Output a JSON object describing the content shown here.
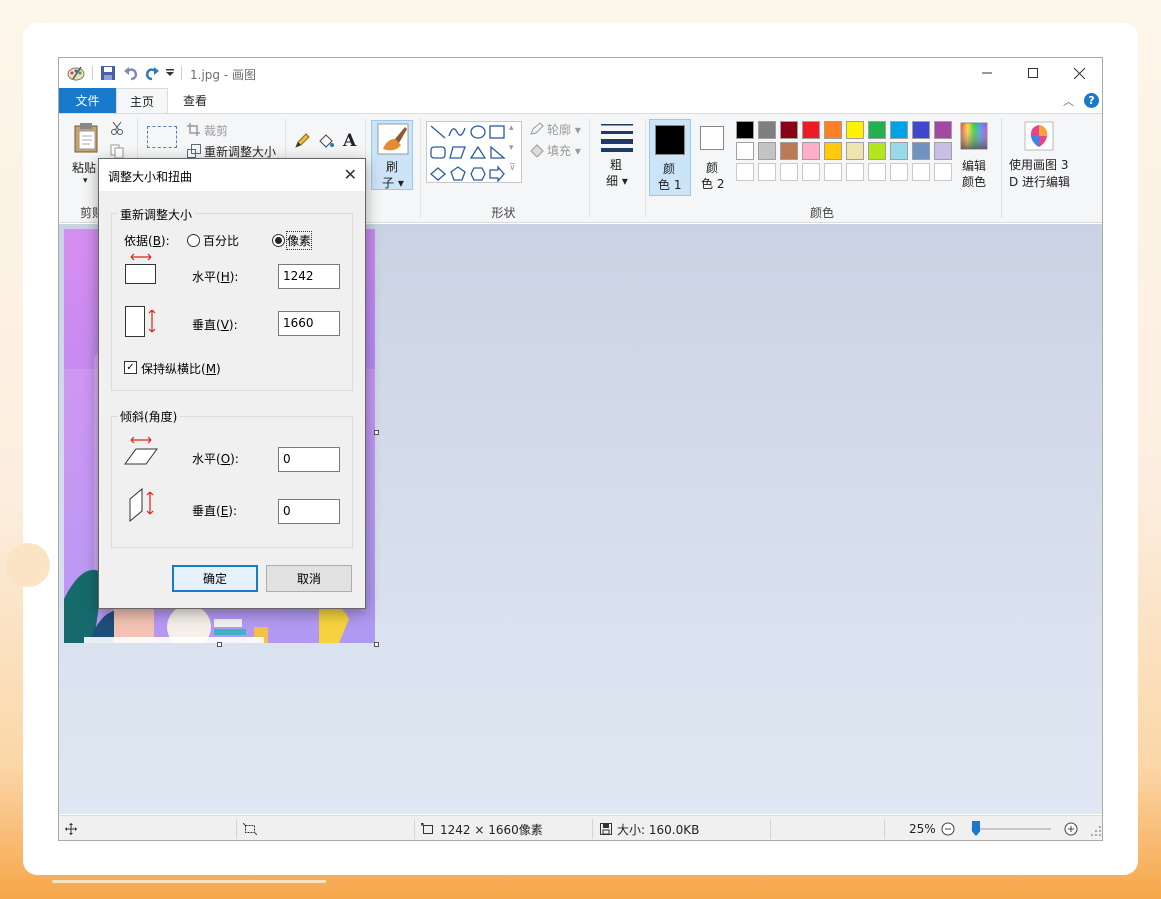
{
  "window": {
    "title": "1.jpg - 画图"
  },
  "tabs": {
    "file": "文件",
    "home": "主页",
    "view": "查看"
  },
  "ribbon": {
    "clipboard": {
      "paste": "粘贴",
      "group": "剪贴板"
    },
    "image": {
      "crop": "裁剪",
      "resize": "重新调整大小"
    },
    "brushes": {
      "label_line1": "刷",
      "label_line2": "子"
    },
    "shapes": {
      "outline": "轮廓",
      "fill": "填充",
      "group": "形状"
    },
    "size": {
      "label_line1": "粗",
      "label_line2": "细"
    },
    "colors": {
      "color1_line1": "颜",
      "color1_line2": "色 1",
      "color2_line1": "颜",
      "color2_line2": "色 2",
      "edit_line1": "编辑",
      "edit_line2": "颜色",
      "group": "颜色",
      "palette_row1": [
        "#000000",
        "#7f7f7f",
        "#880015",
        "#ed1c24",
        "#ff7f27",
        "#fff200",
        "#22b14c",
        "#00a2e8",
        "#3f48cc",
        "#a349a4"
      ],
      "palette_row2": [
        "#ffffff",
        "#c3c3c3",
        "#b97a57",
        "#ffaec9",
        "#ffc90e",
        "#efe4b0",
        "#b5e61d",
        "#99d9ea",
        "#7092be",
        "#c8bfe7"
      ]
    },
    "paint3d": {
      "line1": "使用画图 3",
      "line2": "D 进行编辑"
    }
  },
  "dialog": {
    "title": "调整大小和扭曲",
    "resize_group": "重新调整大小",
    "by_label": "依据(B):",
    "percent": "百分比",
    "pixels": "像素",
    "horizontal_label": "水平(H):",
    "horizontal_value": "1242",
    "vertical_label": "垂直(V):",
    "vertical_value": "1660",
    "keep_ratio": "保持纵横比(M)",
    "skew_group": "倾斜(角度)",
    "skew_h_label": "水平(O):",
    "skew_h_value": "0",
    "skew_v_label": "垂直(E):",
    "skew_v_value": "0",
    "ok": "确定",
    "cancel": "取消"
  },
  "status": {
    "dimensions": "1242 × 1660像素",
    "size": "大小: 160.0KB",
    "zoom": "25%"
  }
}
